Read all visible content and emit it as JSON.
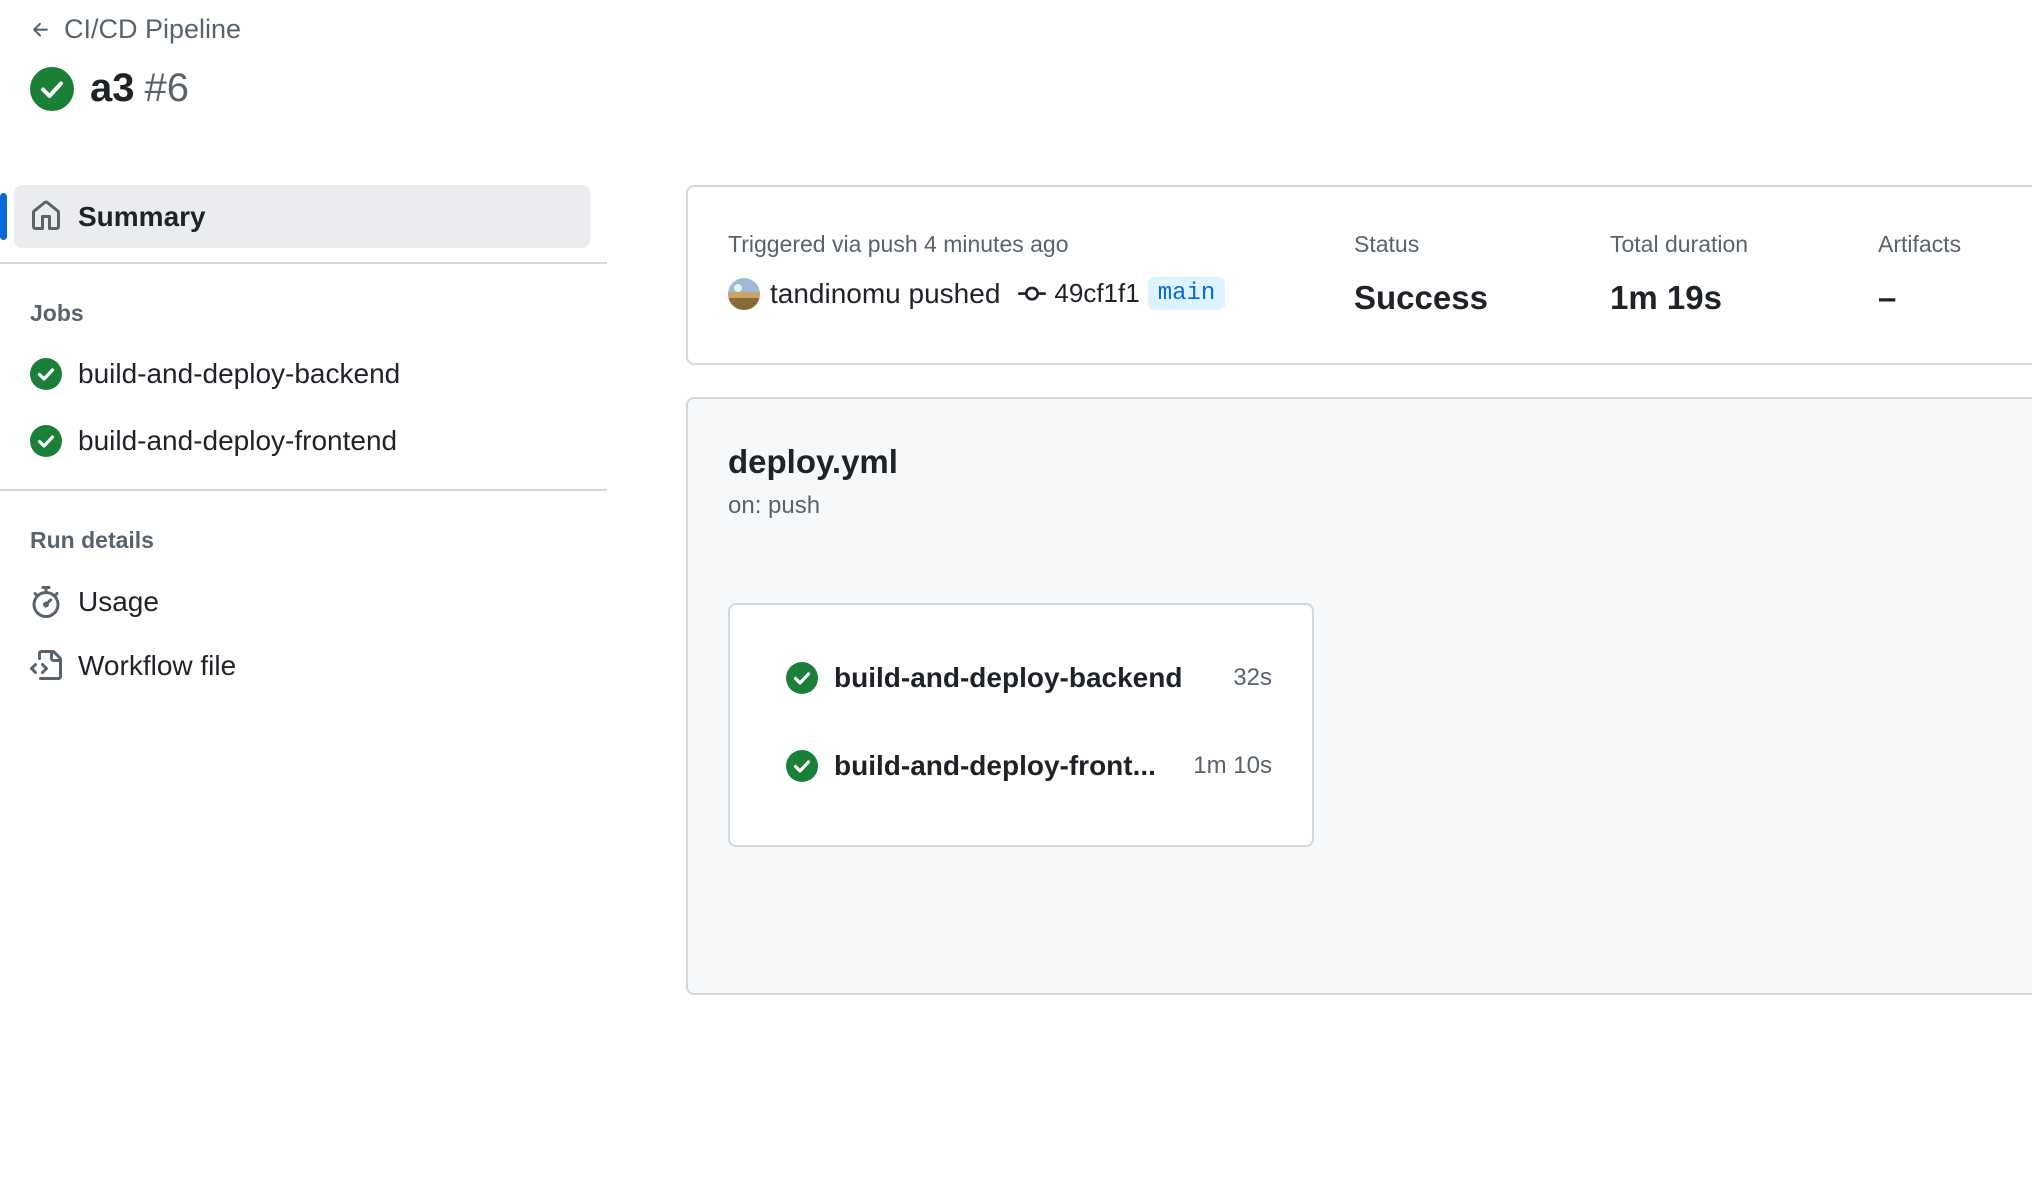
{
  "header": {
    "back_label": "CI/CD Pipeline",
    "run_name": "a3",
    "run_number": "#6"
  },
  "sidebar": {
    "summary_label": "Summary",
    "jobs_heading": "Jobs",
    "jobs": [
      {
        "label": "build-and-deploy-backend",
        "status": "success"
      },
      {
        "label": "build-and-deploy-frontend",
        "status": "success"
      }
    ],
    "run_details_heading": "Run details",
    "run_details": [
      {
        "label": "Usage",
        "icon": "stopwatch-icon"
      },
      {
        "label": "Workflow file",
        "icon": "file-code-icon"
      }
    ]
  },
  "summary": {
    "trigger_text": "Triggered via push 4 minutes ago",
    "actor_text": "tandinomu pushed",
    "commit_sha": "49cf1f1",
    "branch": "main",
    "status_label": "Status",
    "status_value": "Success",
    "duration_label": "Total duration",
    "duration_value": "1m 19s",
    "artifacts_label": "Artifacts",
    "artifacts_value": "–"
  },
  "workflow": {
    "file_name": "deploy.yml",
    "trigger": "on: push",
    "jobs": [
      {
        "name": "build-and-deploy-backend",
        "duration": "32s"
      },
      {
        "name": "build-and-deploy-front...",
        "duration": "1m 10s"
      }
    ]
  },
  "colors": {
    "success": "#1a7f37",
    "accent": "#0969da",
    "muted": "#59636e",
    "border": "#d1d9e0"
  }
}
